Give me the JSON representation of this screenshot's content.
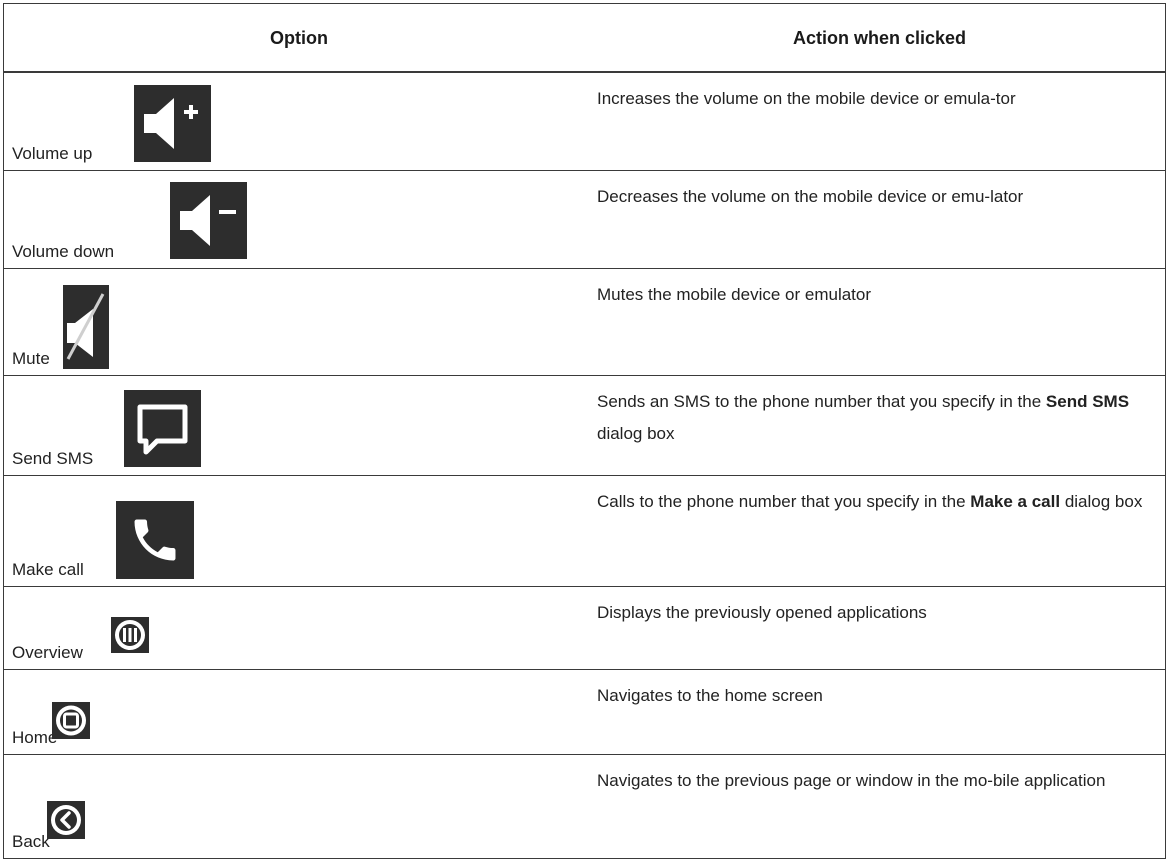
{
  "table": {
    "headers": {
      "option": "Option",
      "action": "Action when clicked"
    },
    "rows": [
      {
        "option": "Volume up",
        "icon": "volume-up-icon",
        "action": "Increases the volume on the mobile device or emula-tor"
      },
      {
        "option": "Volume down",
        "icon": "volume-down-icon",
        "action": "Decreases the volume on the mobile device or emu-lator"
      },
      {
        "option": "Mute",
        "icon": "mute-icon",
        "action": "Mutes the mobile device or emulator"
      },
      {
        "option": "Send SMS",
        "icon": "sms-icon",
        "action_before": "Sends an SMS to the phone number that you specify in the",
        "action_bold": "Send SMS",
        "action_after": "dialog box"
      },
      {
        "option": "Make call",
        "icon": "phone-icon",
        "action_before": "Calls to the phone number that you specify in the",
        "action_bold": "Make a call",
        "action_after": "dialog box"
      },
      {
        "option": "Overview",
        "icon": "overview-icon",
        "action": "Displays the previously opened applications"
      },
      {
        "option": "Home",
        "icon": "home-icon",
        "action": "Navigates to the home screen"
      },
      {
        "option": "Back",
        "icon": "back-icon",
        "action": "Navigates to the previous page or window in the mo-bile application"
      }
    ]
  },
  "colors": {
    "icon_bg": "#2d2d2d",
    "icon_fg": "#ffffff",
    "border": "#3a3a3a",
    "text": "#222222"
  }
}
